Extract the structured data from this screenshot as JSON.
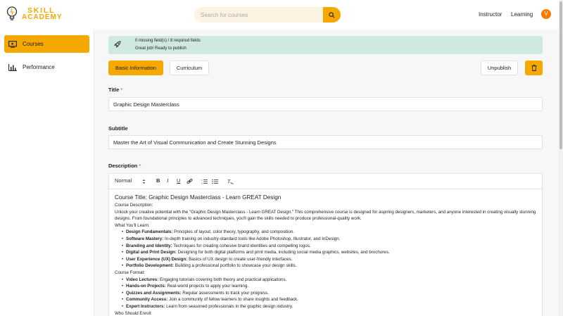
{
  "header": {
    "logo_line1": "SKILL",
    "logo_line2": "ACADEMY",
    "search_placeholder": "Search for courses",
    "nav_instructor": "Instructor",
    "nav_learning": "Learning",
    "avatar_initial": "V"
  },
  "colors": {
    "accent": "#f5a800",
    "banner": "#cfe8e0",
    "avatar": "#f57c00"
  },
  "sidebar": {
    "items": [
      {
        "label": "Courses",
        "icon": "video-icon",
        "active": true
      },
      {
        "label": "Performance",
        "icon": "bar-chart-icon",
        "active": false
      }
    ]
  },
  "banner": {
    "line1": "0 missing field(s) / 8 required fields",
    "line2": "Great job! Ready to publish",
    "icon": "rocket-icon"
  },
  "tabs": {
    "basic": "Basic Information",
    "curriculum": "Curriculum"
  },
  "actions": {
    "unpublish": "Unpublish",
    "delete_icon": "trash-icon"
  },
  "form": {
    "title_label": "Title",
    "title_req": "*",
    "title_value": "Graphic Design Masterclass",
    "subtitle_label": "Subtitle",
    "subtitle_value": "Master the Art of Visual Communication and Create Stunning Designs",
    "description_label": "Description",
    "description_req": "*"
  },
  "editor": {
    "format_select": "Normal",
    "toolbar_icons": [
      "bold-icon",
      "italic-icon",
      "underline-icon",
      "link-icon",
      "ordered-list-icon",
      "bullet-list-icon",
      "clear-format-icon"
    ],
    "heading": "Course Title: Graphic Design Masterclass - Learn GREAT Design",
    "course_desc_label": "Course Description:",
    "intro": "Unlock your creative potential with the \"Graphic Design Masterclass - Learn GREAT Design.\" This comprehensive course is designed for aspiring designers, marketers, and anyone interested in creating visually stunning designs. From foundational principles to advanced techniques, you'll gain the skills needed to produce professional-quality work.",
    "learn_label": "What You'll Learn:",
    "learn_items": [
      {
        "b": "Design Fundamentals:",
        "t": " Principles of layout, color theory, typography, and composition."
      },
      {
        "b": "Software Mastery:",
        "t": " In-depth training on industry-standard tools like Adobe Photoshop, Illustrator, and InDesign."
      },
      {
        "b": "Branding and Identity:",
        "t": " Techniques for creating cohesive brand identities and compelling logos."
      },
      {
        "b": "Digital and Print Design:",
        "t": " Designing for both digital platforms and print media, including social media graphics, websites, and brochures."
      },
      {
        "b": "User Experience (UX) Design:",
        "t": " Basics of UX design to create user-friendly interfaces."
      },
      {
        "b": "Portfolio Development:",
        "t": " Building a professional portfolio to showcase your design skills."
      }
    ],
    "format_label": "Course Format:",
    "format_items": [
      {
        "b": "Video Lectures:",
        "t": " Engaging tutorials covering both theory and practical applications."
      },
      {
        "b": "Hands-on Projects:",
        "t": " Real-world projects to apply your learning."
      },
      {
        "b": "Quizzes and Assignments:",
        "t": " Regular assessments to track your progress."
      },
      {
        "b": "Community Access:",
        "t": " Join a community of fellow learners to share insights and feedback."
      },
      {
        "b": "Expert Instructors:",
        "t": " Learn from seasoned professionals in the graphic design industry."
      }
    ],
    "enroll_label": "Who Should Enroll:"
  }
}
